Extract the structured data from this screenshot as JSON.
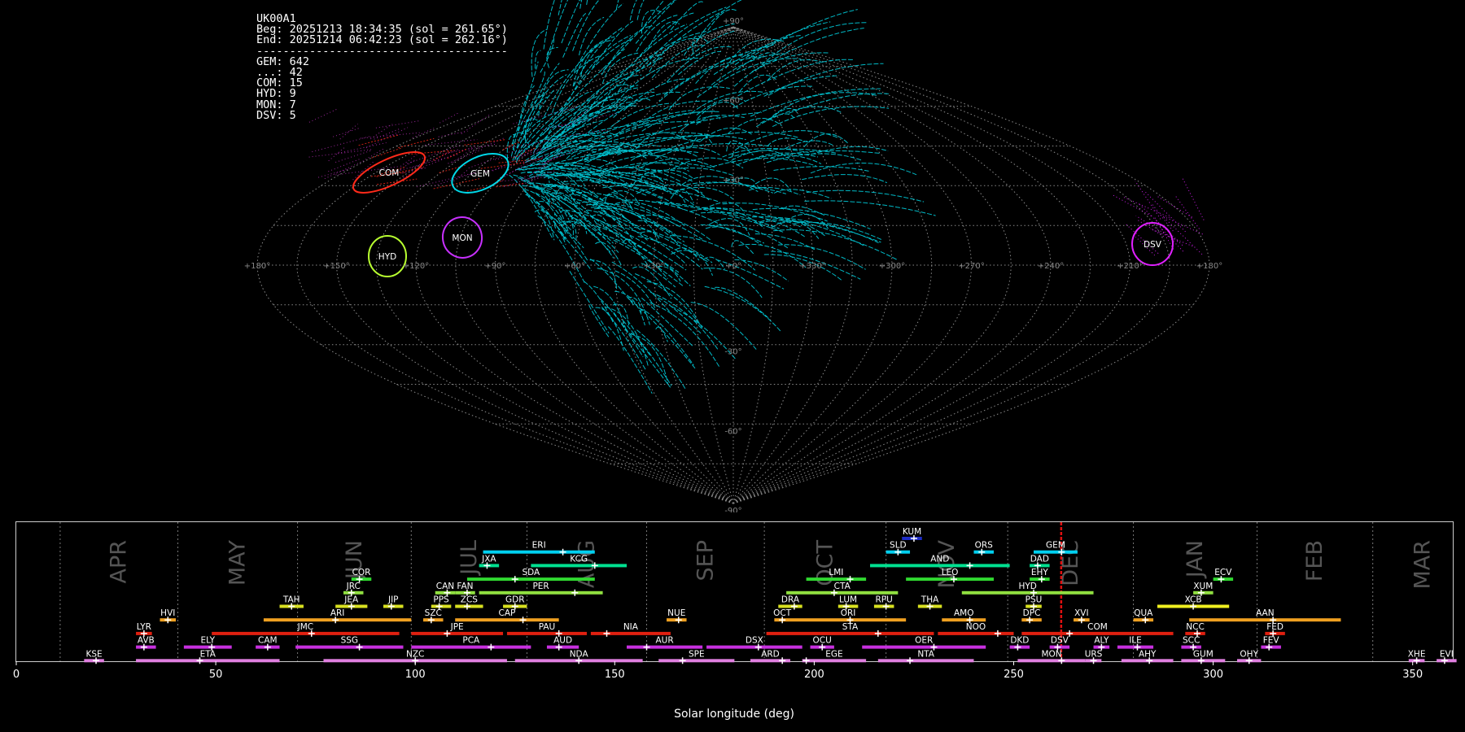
{
  "header": {
    "station": "UK00A1",
    "begin": "Beg: 20251213 18:34:35 (sol = 261.65°)",
    "end": "End: 20251214 06:42:23 (sol = 262.16°)",
    "divider": "--------------------------------------",
    "counts": [
      "GEM: 642",
      "...: 42",
      "COM: 15",
      "HYD: 9",
      "MON: 7",
      "DSV: 5"
    ]
  },
  "sky_map": {
    "projection": "sinusoidal",
    "lon_tick_labels": [
      "+180°",
      "+150°",
      "+120°",
      "+90°",
      "+60°",
      "+30°",
      "+0°",
      "+330°",
      "+300°",
      "+270°",
      "+240°",
      "+210°",
      "+180°"
    ],
    "lat_tick_labels": [
      "+90°",
      "+60°",
      "+30°",
      "-30°",
      "-60°",
      "-90°"
    ],
    "radiants": [
      {
        "code": "GEM",
        "color": "#00d8e8"
      },
      {
        "code": "COM",
        "color": "#ff2a1a"
      },
      {
        "code": "MON",
        "color": "#c830ff"
      },
      {
        "code": "HYD",
        "color": "#b8ff30"
      },
      {
        "code": "DSV",
        "color": "#e020ff"
      }
    ]
  },
  "chart_data": {
    "type": "timeline",
    "xlabel": "Solar longitude (deg)",
    "xlim": [
      0,
      365
    ],
    "xticks": [
      0,
      50,
      100,
      150,
      200,
      250,
      300,
      350
    ],
    "current_sol": 261.9,
    "months": [
      {
        "label": "APR",
        "start": 11,
        "end": 40.5
      },
      {
        "label": "MAY",
        "start": 40.5,
        "end": 70.5
      },
      {
        "label": "JUN",
        "start": 70.5,
        "end": 99
      },
      {
        "label": "JUL",
        "start": 99,
        "end": 128
      },
      {
        "label": "AUG",
        "start": 128,
        "end": 158
      },
      {
        "label": "SEP",
        "start": 158,
        "end": 187.5
      },
      {
        "label": "OCT",
        "start": 187.5,
        "end": 218
      },
      {
        "label": "NOV",
        "start": 218,
        "end": 248.5
      },
      {
        "label": "DEC",
        "start": 248.5,
        "end": 280
      },
      {
        "label": "JAN",
        "start": 280,
        "end": 311
      },
      {
        "label": "FEB",
        "start": 311,
        "end": 340
      },
      {
        "label": "MAR",
        "start": 340,
        "end": 365
      }
    ],
    "showers": [
      {
        "code": "KUM",
        "start": 222,
        "end": 227,
        "peak": 225,
        "row": 10,
        "color": "#1e2cc8"
      },
      {
        "code": "ERI",
        "start": 117,
        "end": 145,
        "peak": 137,
        "row": 9,
        "color": "#00d0f0"
      },
      {
        "code": "SLD",
        "start": 218,
        "end": 224,
        "peak": 221,
        "row": 9,
        "color": "#00d0f0"
      },
      {
        "code": "ORS",
        "start": 240,
        "end": 245,
        "peak": 242,
        "row": 9,
        "color": "#00d0f0"
      },
      {
        "code": "GEM",
        "start": 255,
        "end": 266,
        "peak": 262,
        "row": 9,
        "color": "#00d0f0"
      },
      {
        "code": "JXA",
        "start": 116,
        "end": 121,
        "peak": 118,
        "row": 8,
        "color": "#00e090"
      },
      {
        "code": "KCG",
        "start": 129,
        "end": 153,
        "peak": 145,
        "row": 8,
        "color": "#00e090"
      },
      {
        "code": "AND",
        "start": 214,
        "end": 249,
        "peak": 239,
        "row": 8,
        "color": "#00e090"
      },
      {
        "code": "DAD",
        "start": 254,
        "end": 259,
        "peak": 256,
        "row": 8,
        "color": "#00e090"
      },
      {
        "code": "COR",
        "start": 84,
        "end": 89,
        "peak": 86,
        "row": 7,
        "color": "#30d830"
      },
      {
        "code": "SDA",
        "start": 113,
        "end": 145,
        "peak": 125,
        "row": 7,
        "color": "#30d830"
      },
      {
        "code": "LMI",
        "start": 198,
        "end": 213,
        "peak": 209,
        "row": 7,
        "color": "#30d830"
      },
      {
        "code": "LEO",
        "start": 223,
        "end": 245,
        "peak": 235,
        "row": 7,
        "color": "#30d830"
      },
      {
        "code": "EHY",
        "start": 254,
        "end": 259,
        "peak": 257,
        "row": 7,
        "color": "#30d830"
      },
      {
        "code": "ECV",
        "start": 300,
        "end": 305,
        "peak": 302,
        "row": 7,
        "color": "#30d830"
      },
      {
        "code": "JRC",
        "start": 82,
        "end": 87,
        "peak": 84,
        "row": 6,
        "color": "#90e040"
      },
      {
        "code": "CAN",
        "start": 105,
        "end": 110,
        "peak": 108,
        "row": 6,
        "color": "#90e040"
      },
      {
        "code": "FAN",
        "start": 110,
        "end": 115,
        "peak": 113,
        "row": 6,
        "color": "#90e040"
      },
      {
        "code": "PER",
        "start": 116,
        "end": 147,
        "peak": 140,
        "row": 6,
        "color": "#90e040"
      },
      {
        "code": "CTA",
        "start": 193,
        "end": 221,
        "peak": 205,
        "row": 6,
        "color": "#90e040"
      },
      {
        "code": "HYD",
        "start": 237,
        "end": 270,
        "peak": 255,
        "row": 6,
        "color": "#90e040"
      },
      {
        "code": "XUM",
        "start": 295,
        "end": 300,
        "peak": 297,
        "row": 6,
        "color": "#90e040"
      },
      {
        "code": "TAH",
        "start": 66,
        "end": 72,
        "peak": 69,
        "row": 5,
        "color": "#d8e020"
      },
      {
        "code": "JEA",
        "start": 80,
        "end": 88,
        "peak": 84,
        "row": 5,
        "color": "#d8e020"
      },
      {
        "code": "JIP",
        "start": 92,
        "end": 97,
        "peak": 94,
        "row": 5,
        "color": "#d8e020"
      },
      {
        "code": "PPS",
        "start": 104,
        "end": 109,
        "peak": 106,
        "row": 5,
        "color": "#d8e020"
      },
      {
        "code": "ZCS",
        "start": 110,
        "end": 117,
        "peak": 113,
        "row": 5,
        "color": "#d8e020"
      },
      {
        "code": "GDR",
        "start": 122,
        "end": 128,
        "peak": 125,
        "row": 5,
        "color": "#d8e020"
      },
      {
        "code": "DRA",
        "start": 191,
        "end": 197,
        "peak": 195,
        "row": 5,
        "color": "#d8e020"
      },
      {
        "code": "LUM",
        "start": 206,
        "end": 211,
        "peak": 208,
        "row": 5,
        "color": "#d8e020"
      },
      {
        "code": "RPU",
        "start": 215,
        "end": 220,
        "peak": 218,
        "row": 5,
        "color": "#d8e020"
      },
      {
        "code": "THA",
        "start": 226,
        "end": 232,
        "peak": 229,
        "row": 5,
        "color": "#d8e020"
      },
      {
        "code": "PSU",
        "start": 253,
        "end": 257,
        "peak": 255,
        "row": 5,
        "color": "#d8e020"
      },
      {
        "code": "XCB",
        "start": 286,
        "end": 304,
        "peak": 295,
        "row": 5,
        "color": "#f0f020"
      },
      {
        "code": "HVI",
        "start": 36,
        "end": 40,
        "peak": 38,
        "row": 4,
        "color": "#f0a020"
      },
      {
        "code": "ARI",
        "start": 62,
        "end": 99,
        "peak": 80,
        "row": 4,
        "color": "#f0a020"
      },
      {
        "code": "SZC",
        "start": 102,
        "end": 107,
        "peak": 104,
        "row": 4,
        "color": "#f0a020"
      },
      {
        "code": "CAP",
        "start": 110,
        "end": 136,
        "peak": 127,
        "row": 4,
        "color": "#f0a020"
      },
      {
        "code": "NUE",
        "start": 163,
        "end": 168,
        "peak": 166,
        "row": 4,
        "color": "#f0a020"
      },
      {
        "code": "OCT",
        "start": 190,
        "end": 194,
        "peak": 192,
        "row": 4,
        "color": "#f0a020"
      },
      {
        "code": "ORI",
        "start": 194,
        "end": 223,
        "peak": 209,
        "row": 4,
        "color": "#f0a020"
      },
      {
        "code": "AMO",
        "start": 232,
        "end": 243,
        "peak": 239,
        "row": 4,
        "color": "#f0a020"
      },
      {
        "code": "DPC",
        "start": 252,
        "end": 257,
        "peak": 254,
        "row": 4,
        "color": "#f0a020"
      },
      {
        "code": "XVI",
        "start": 265,
        "end": 269,
        "peak": 267,
        "row": 4,
        "color": "#f0a020"
      },
      {
        "code": "QUA",
        "start": 280,
        "end": 285,
        "peak": 283,
        "row": 4,
        "color": "#f0a020"
      },
      {
        "code": "AAN",
        "start": 294,
        "end": 332,
        "peak": 315,
        "row": 4,
        "color": "#f0a020"
      },
      {
        "code": "LYR",
        "start": 30,
        "end": 34,
        "peak": 32,
        "row": 3,
        "color": "#e02010"
      },
      {
        "code": "JMC",
        "start": 49,
        "end": 96,
        "peak": 74,
        "row": 3,
        "color": "#e02010"
      },
      {
        "code": "JPE",
        "start": 99,
        "end": 122,
        "peak": 108,
        "row": 3,
        "color": "#e02010"
      },
      {
        "code": "PAU",
        "start": 123,
        "end": 143,
        "peak": 136,
        "row": 3,
        "color": "#e02010"
      },
      {
        "code": "NIA",
        "start": 144,
        "end": 164,
        "peak": 148,
        "row": 3,
        "color": "#e02010"
      },
      {
        "code": "STA",
        "start": 188,
        "end": 230,
        "peak": 216,
        "row": 3,
        "color": "#e02010"
      },
      {
        "code": "NOO",
        "start": 231,
        "end": 250,
        "peak": 246,
        "row": 3,
        "color": "#e02010"
      },
      {
        "code": "COM",
        "start": 252,
        "end": 290,
        "peak": 264,
        "row": 3,
        "color": "#e02010"
      },
      {
        "code": "NCC",
        "start": 293,
        "end": 298,
        "peak": 296,
        "row": 3,
        "color": "#e02010"
      },
      {
        "code": "FED",
        "start": 313,
        "end": 318,
        "peak": 315,
        "row": 3,
        "color": "#e02010"
      },
      {
        "code": "AVB",
        "start": 30,
        "end": 35,
        "peak": 32,
        "row": 2,
        "color": "#c830e0"
      },
      {
        "code": "ELY",
        "start": 42,
        "end": 54,
        "peak": 49,
        "row": 2,
        "color": "#c830e0"
      },
      {
        "code": "CAM",
        "start": 60,
        "end": 66,
        "peak": 63,
        "row": 2,
        "color": "#c830e0"
      },
      {
        "code": "SSG",
        "start": 70,
        "end": 97,
        "peak": 86,
        "row": 2,
        "color": "#c830e0"
      },
      {
        "code": "PCA",
        "start": 99,
        "end": 129,
        "peak": 119,
        "row": 2,
        "color": "#c830e0"
      },
      {
        "code": "AUD",
        "start": 133,
        "end": 141,
        "peak": 136,
        "row": 2,
        "color": "#c830e0"
      },
      {
        "code": "AUR",
        "start": 153,
        "end": 172,
        "peak": 158,
        "row": 2,
        "color": "#c830e0"
      },
      {
        "code": "DSX",
        "start": 173,
        "end": 197,
        "peak": 186,
        "row": 2,
        "color": "#c830e0"
      },
      {
        "code": "OCU",
        "start": 199,
        "end": 205,
        "peak": 202,
        "row": 2,
        "color": "#c830e0"
      },
      {
        "code": "OER",
        "start": 212,
        "end": 243,
        "peak": 230,
        "row": 2,
        "color": "#c830e0"
      },
      {
        "code": "DKD",
        "start": 249,
        "end": 254,
        "peak": 251,
        "row": 2,
        "color": "#c830e0"
      },
      {
        "code": "DSV",
        "start": 259,
        "end": 264,
        "peak": 261,
        "row": 2,
        "color": "#c830e0"
      },
      {
        "code": "ALY",
        "start": 270,
        "end": 274,
        "peak": 272,
        "row": 2,
        "color": "#c830e0"
      },
      {
        "code": "ILE",
        "start": 276,
        "end": 285,
        "peak": 281,
        "row": 2,
        "color": "#c830e0"
      },
      {
        "code": "SCC",
        "start": 292,
        "end": 297,
        "peak": 295,
        "row": 2,
        "color": "#c830e0"
      },
      {
        "code": "FEV",
        "start": 312,
        "end": 317,
        "peak": 314,
        "row": 2,
        "color": "#c830e0"
      },
      {
        "code": "KSE",
        "start": 17,
        "end": 22,
        "peak": 20,
        "row": 1,
        "color": "#e080e0"
      },
      {
        "code": "ETA",
        "start": 30,
        "end": 66,
        "peak": 46,
        "row": 1,
        "color": "#e080e0"
      },
      {
        "code": "NZC",
        "start": 77,
        "end": 123,
        "peak": 100,
        "row": 1,
        "color": "#e080e0"
      },
      {
        "code": "NDA",
        "start": 125,
        "end": 157,
        "peak": 141,
        "row": 1,
        "color": "#e080e0"
      },
      {
        "code": "SPE",
        "start": 161,
        "end": 180,
        "peak": 167,
        "row": 1,
        "color": "#e080e0"
      },
      {
        "code": "ARD",
        "start": 184,
        "end": 194,
        "peak": 192,
        "row": 1,
        "color": "#e080e0"
      },
      {
        "code": "EGE",
        "start": 197,
        "end": 213,
        "peak": 198,
        "row": 1,
        "color": "#e080e0"
      },
      {
        "code": "NTA",
        "start": 216,
        "end": 240,
        "peak": 224,
        "row": 1,
        "color": "#e080e0"
      },
      {
        "code": "MON",
        "start": 251,
        "end": 268,
        "peak": 262,
        "row": 1,
        "color": "#e080e0"
      },
      {
        "code": "URS",
        "start": 268,
        "end": 272,
        "peak": 270,
        "row": 1,
        "color": "#e080e0"
      },
      {
        "code": "AHY",
        "start": 277,
        "end": 290,
        "peak": 284,
        "row": 1,
        "color": "#e080e0"
      },
      {
        "code": "GUM",
        "start": 292,
        "end": 303,
        "peak": 297,
        "row": 1,
        "color": "#e080e0"
      },
      {
        "code": "OHY",
        "start": 306,
        "end": 312,
        "peak": 309,
        "row": 1,
        "color": "#e080e0"
      },
      {
        "code": "XHE",
        "start": 349,
        "end": 353,
        "peak": 351,
        "row": 1,
        "color": "#e080e0"
      },
      {
        "code": "EVI",
        "start": 356,
        "end": 361,
        "peak": 358,
        "row": 1,
        "color": "#e080e0"
      }
    ]
  }
}
